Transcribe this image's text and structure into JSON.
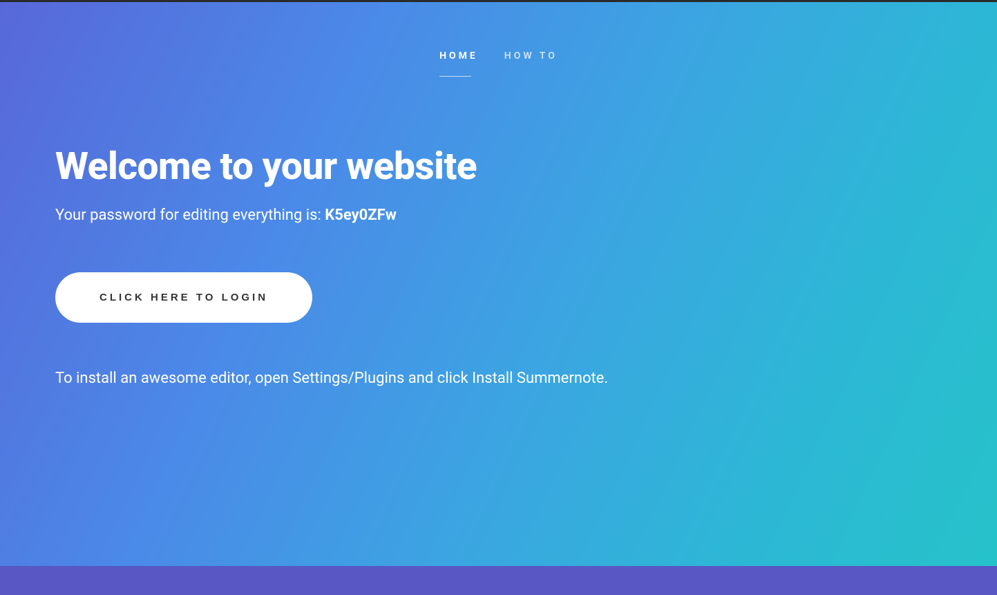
{
  "nav": {
    "items": [
      {
        "label": "Home",
        "active": true
      },
      {
        "label": "How To",
        "active": false
      }
    ]
  },
  "hero": {
    "heading": "Welcome to your website",
    "password_prefix": "Your password for editing everything is: ",
    "password_value": "K5ey0ZFw",
    "login_button": "CLICK HERE TO LOGIN",
    "instruction": "To install an awesome editor, open Settings/Plugins and click Install Summernote."
  }
}
